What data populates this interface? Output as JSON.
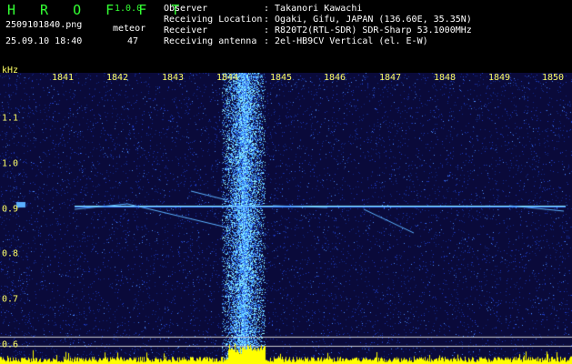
{
  "header": {
    "app_name": "H R O F F T",
    "version": "1.0.0",
    "filename": "2509101840.png",
    "datetime": "25.09.10 18:40",
    "meteor_label": "meteor",
    "meteor_count": "47"
  },
  "info": [
    {
      "key": "Observer",
      "value": ": Takanori Kawachi"
    },
    {
      "key": "Receiving Location",
      "value": ": Ogaki, Gifu, JAPAN (136.60E, 35.35N)"
    },
    {
      "key": "Receiver",
      "value": ": R820T2(RTL-SDR) SDR-Sharp 53.1000MHz"
    },
    {
      "key": "Receiving antenna",
      "value": ": 2el-HB9CV Vertical (el. E-W)"
    }
  ],
  "waterfall": {
    "y_unit": "kHz",
    "x_ticks": [
      "1841",
      "1842",
      "1843",
      "1844",
      "1845",
      "1846",
      "1847",
      "1848",
      "1849",
      "1850"
    ],
    "y_ticks": [
      "1.1",
      "1.0",
      "0.9",
      "0.8",
      "0.7",
      "0.6"
    ],
    "colors": {
      "background": "#0a0a3a",
      "noise": "#1e3cc8",
      "signal": "#8cf0ff",
      "axis": "#ffff66",
      "spectrum": "#ffff00"
    }
  }
}
